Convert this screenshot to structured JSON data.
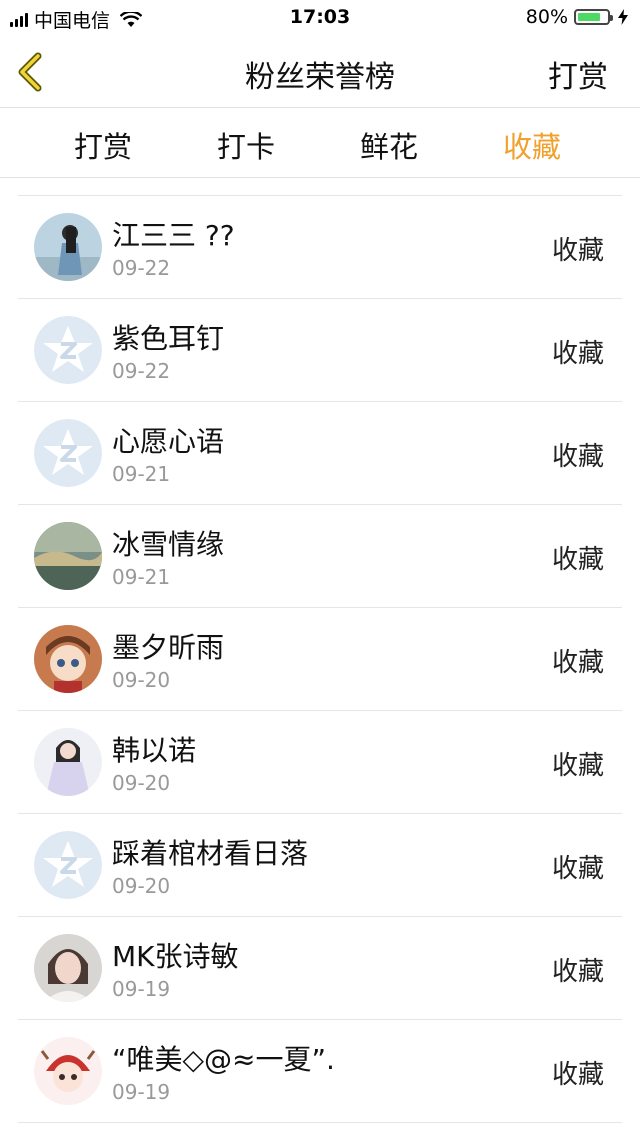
{
  "status": {
    "carrier": "中国电信",
    "time": "17:03",
    "battery": "80%",
    "battery_level": 0.8,
    "battery_color": "#4cd964"
  },
  "nav": {
    "back_icon": "chevron-left-icon",
    "title": "粉丝荣誉榜",
    "right_label": "打赏"
  },
  "tabs": [
    {
      "label": "打赏",
      "active": false
    },
    {
      "label": "打卡",
      "active": false
    },
    {
      "label": "鲜花",
      "active": false
    },
    {
      "label": "收藏",
      "active": true
    }
  ],
  "accent_color": "#f0a12e",
  "list": {
    "items": [
      {
        "name": "江三三 ??",
        "date": "09-22",
        "action": "收藏",
        "avatar": "photo"
      },
      {
        "name": "紫色耳钉",
        "date": "09-22",
        "action": "收藏",
        "avatar": "default"
      },
      {
        "name": "心愿心语",
        "date": "09-21",
        "action": "收藏",
        "avatar": "default"
      },
      {
        "name": "冰雪情缘",
        "date": "09-21",
        "action": "收藏",
        "avatar": "photo"
      },
      {
        "name": "墨夕昕雨",
        "date": "09-20",
        "action": "收藏",
        "avatar": "photo"
      },
      {
        "name": "韩以诺",
        "date": "09-20",
        "action": "收藏",
        "avatar": "photo"
      },
      {
        "name": "踩着棺材看日落",
        "date": "09-20",
        "action": "收藏",
        "avatar": "default"
      },
      {
        "name": "MK张诗敏",
        "date": "09-19",
        "action": "收藏",
        "avatar": "photo"
      },
      {
        "name": "“唯美◇@≈一夏”.",
        "date": "09-19",
        "action": "收藏",
        "avatar": "photo"
      }
    ]
  }
}
